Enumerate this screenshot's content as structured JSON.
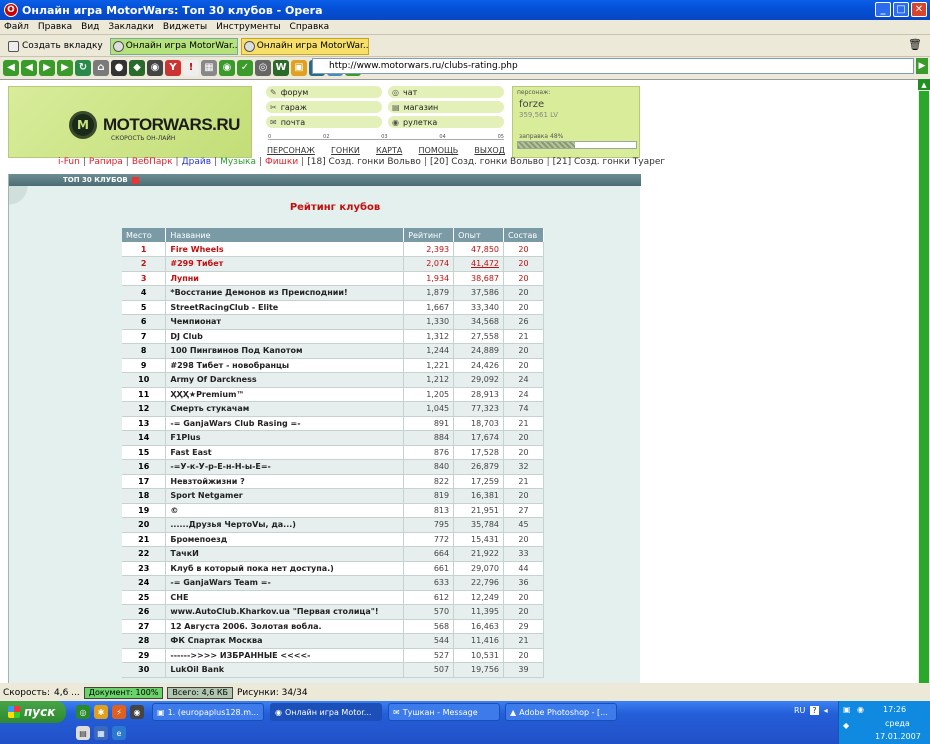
{
  "window": {
    "title": "Онлайн игра MotorWars: Топ 30 клубов - Opera",
    "minimize": "_",
    "maximize": "□",
    "close": "✕"
  },
  "menu": [
    "Файл",
    "Правка",
    "Вид",
    "Закладки",
    "Виджеты",
    "Инструменты",
    "Справка"
  ],
  "tabs": {
    "new_tab": "Создать вкладку",
    "items": [
      {
        "label": "Онлайн игра MotorWar..."
      },
      {
        "label": "Онлайн игра MotorWar..."
      }
    ]
  },
  "address": {
    "url": "http://www.motorwars.ru/clubs-rating.php"
  },
  "site": {
    "logo_text": "MOTORWARS.RU",
    "logo_sub": "СКОРОСТЬ ОН-ЛАЙН",
    "menu": [
      {
        "label": "форум",
        "icon": "✎"
      },
      {
        "label": "чат",
        "icon": "◎"
      },
      {
        "label": "гараж",
        "icon": "✂"
      },
      {
        "label": "магазин",
        "icon": "▤"
      },
      {
        "label": "почта",
        "icon": "✉"
      },
      {
        "label": "рулетка",
        "icon": "◉"
      }
    ],
    "rail_marks": [
      "0",
      "02",
      "03",
      "04",
      "05"
    ],
    "bottom_links": [
      "ПЕРСОНАЖ",
      "ГОНКИ",
      "КАРТА",
      "ПОМОЩЬ",
      "ВЫХОД"
    ],
    "persona": {
      "label": "персонаж:",
      "name": "forze",
      "lv": "359,561 LV",
      "fuel_label": "заправка 48%",
      "fuel_fraction": 0.48
    },
    "links": [
      {
        "text": "i-Fun",
        "color": "#e0222b"
      },
      {
        "text": "Рапира",
        "color": "#e0222b"
      },
      {
        "text": "ВебПарк",
        "color": "#e0222b"
      },
      {
        "text": "Драйв",
        "color": "#2a3ad0"
      },
      {
        "text": "Музыка",
        "color": "#2aa02a"
      },
      {
        "text": "Фишки",
        "color": "#e0222b"
      },
      {
        "text": "[18] Созд. гонки Вольво",
        "color": "#333333"
      },
      {
        "text": "[20] Созд. гонки Вольво",
        "color": "#333333"
      },
      {
        "text": "[21] Созд. гонки Туарег",
        "color": "#333333"
      }
    ],
    "panel_title": "ТОП 30 КЛУБОВ",
    "rating_title": "Рейтинг клубов",
    "columns": [
      "Место",
      "Название",
      "Рейтинг",
      "Опыт",
      "Состав"
    ],
    "rows": [
      [
        "1",
        "Fire Wheels",
        "2,393",
        "47,850",
        "20"
      ],
      [
        "2",
        "#299 Тибет",
        "2,074",
        "41,472",
        "20"
      ],
      [
        "3",
        "Лупни",
        "1,934",
        "38,687",
        "20"
      ],
      [
        "4",
        "*Восстание Демонов из Преисподнии!",
        "1,879",
        "37,586",
        "20"
      ],
      [
        "5",
        "StreetRacingClub - Elite",
        "1,667",
        "33,340",
        "20"
      ],
      [
        "6",
        "Чемпионат",
        "1,330",
        "34,568",
        "26"
      ],
      [
        "7",
        "DJ Club",
        "1,312",
        "27,558",
        "21"
      ],
      [
        "8",
        "100 Пингвинов Под Капотом",
        "1,244",
        "24,889",
        "20"
      ],
      [
        "9",
        "#298 Тибет - новобранцы",
        "1,221",
        "24,426",
        "20"
      ],
      [
        "10",
        "Army Of Darckness",
        "1,212",
        "29,092",
        "24"
      ],
      [
        "11",
        "ҲҲҲ★Premium™",
        "1,205",
        "28,913",
        "24"
      ],
      [
        "12",
        "Смерть стукачам",
        "1,045",
        "77,323",
        "74"
      ],
      [
        "13",
        "-= GanjaWars Club Rasing =-",
        "891",
        "18,703",
        "21"
      ],
      [
        "14",
        "F1Plus",
        "884",
        "17,674",
        "20"
      ],
      [
        "15",
        "Fast East",
        "876",
        "17,528",
        "20"
      ],
      [
        "16",
        "-=У-к-У-р-Е-н-Н-ы-Е=-",
        "840",
        "26,879",
        "32"
      ],
      [
        "17",
        "Невзтойжизни ?",
        "822",
        "17,259",
        "21"
      ],
      [
        "18",
        "Sport Netgamer",
        "819",
        "16,381",
        "20"
      ],
      [
        "19",
        "©",
        "813",
        "21,951",
        "27"
      ],
      [
        "20",
        "......Друзья ЧертоVы, да...)",
        "795",
        "35,784",
        "45"
      ],
      [
        "21",
        "Бромепоезд",
        "772",
        "15,431",
        "20"
      ],
      [
        "22",
        "ТачкИ",
        "664",
        "21,922",
        "33"
      ],
      [
        "23",
        "Клуб в который пока нет доступа.)",
        "661",
        "29,070",
        "44"
      ],
      [
        "24",
        "-= GanjaWars Team =-",
        "633",
        "22,796",
        "36"
      ],
      [
        "25",
        "CHE",
        "612",
        "12,249",
        "20"
      ],
      [
        "26",
        "www.AutoClub.Kharkov.ua \"Первая столица\"!",
        "570",
        "11,395",
        "20"
      ],
      [
        "27",
        "12 Августа 2006. Золотая вобла.",
        "568",
        "16,463",
        "29"
      ],
      [
        "28",
        "ФК Спартак Москва",
        "544",
        "11,416",
        "21"
      ],
      [
        "29",
        "------>>>> ИЗБРАННЫЕ <<<<-",
        "527",
        "10,531",
        "20"
      ],
      [
        "30",
        "LukOil Bank",
        "507",
        "19,756",
        "39"
      ]
    ]
  },
  "status": {
    "speed_label": "Скорость:",
    "speed_value": "4,6 ...",
    "doc": "Документ:  100%",
    "total": "Всего:  4,6 КБ",
    "images": "Рисунки:  34/34"
  },
  "taskbar": {
    "start": "пуск",
    "tasks": [
      "1. (europaplus128.m...",
      "Онлайн игра Motor...",
      "Тушкан - Message",
      "Adobe Photoshop - [..."
    ],
    "lang": "RU",
    "time": "17:26",
    "day": "среда",
    "date": "17.01.2007"
  }
}
